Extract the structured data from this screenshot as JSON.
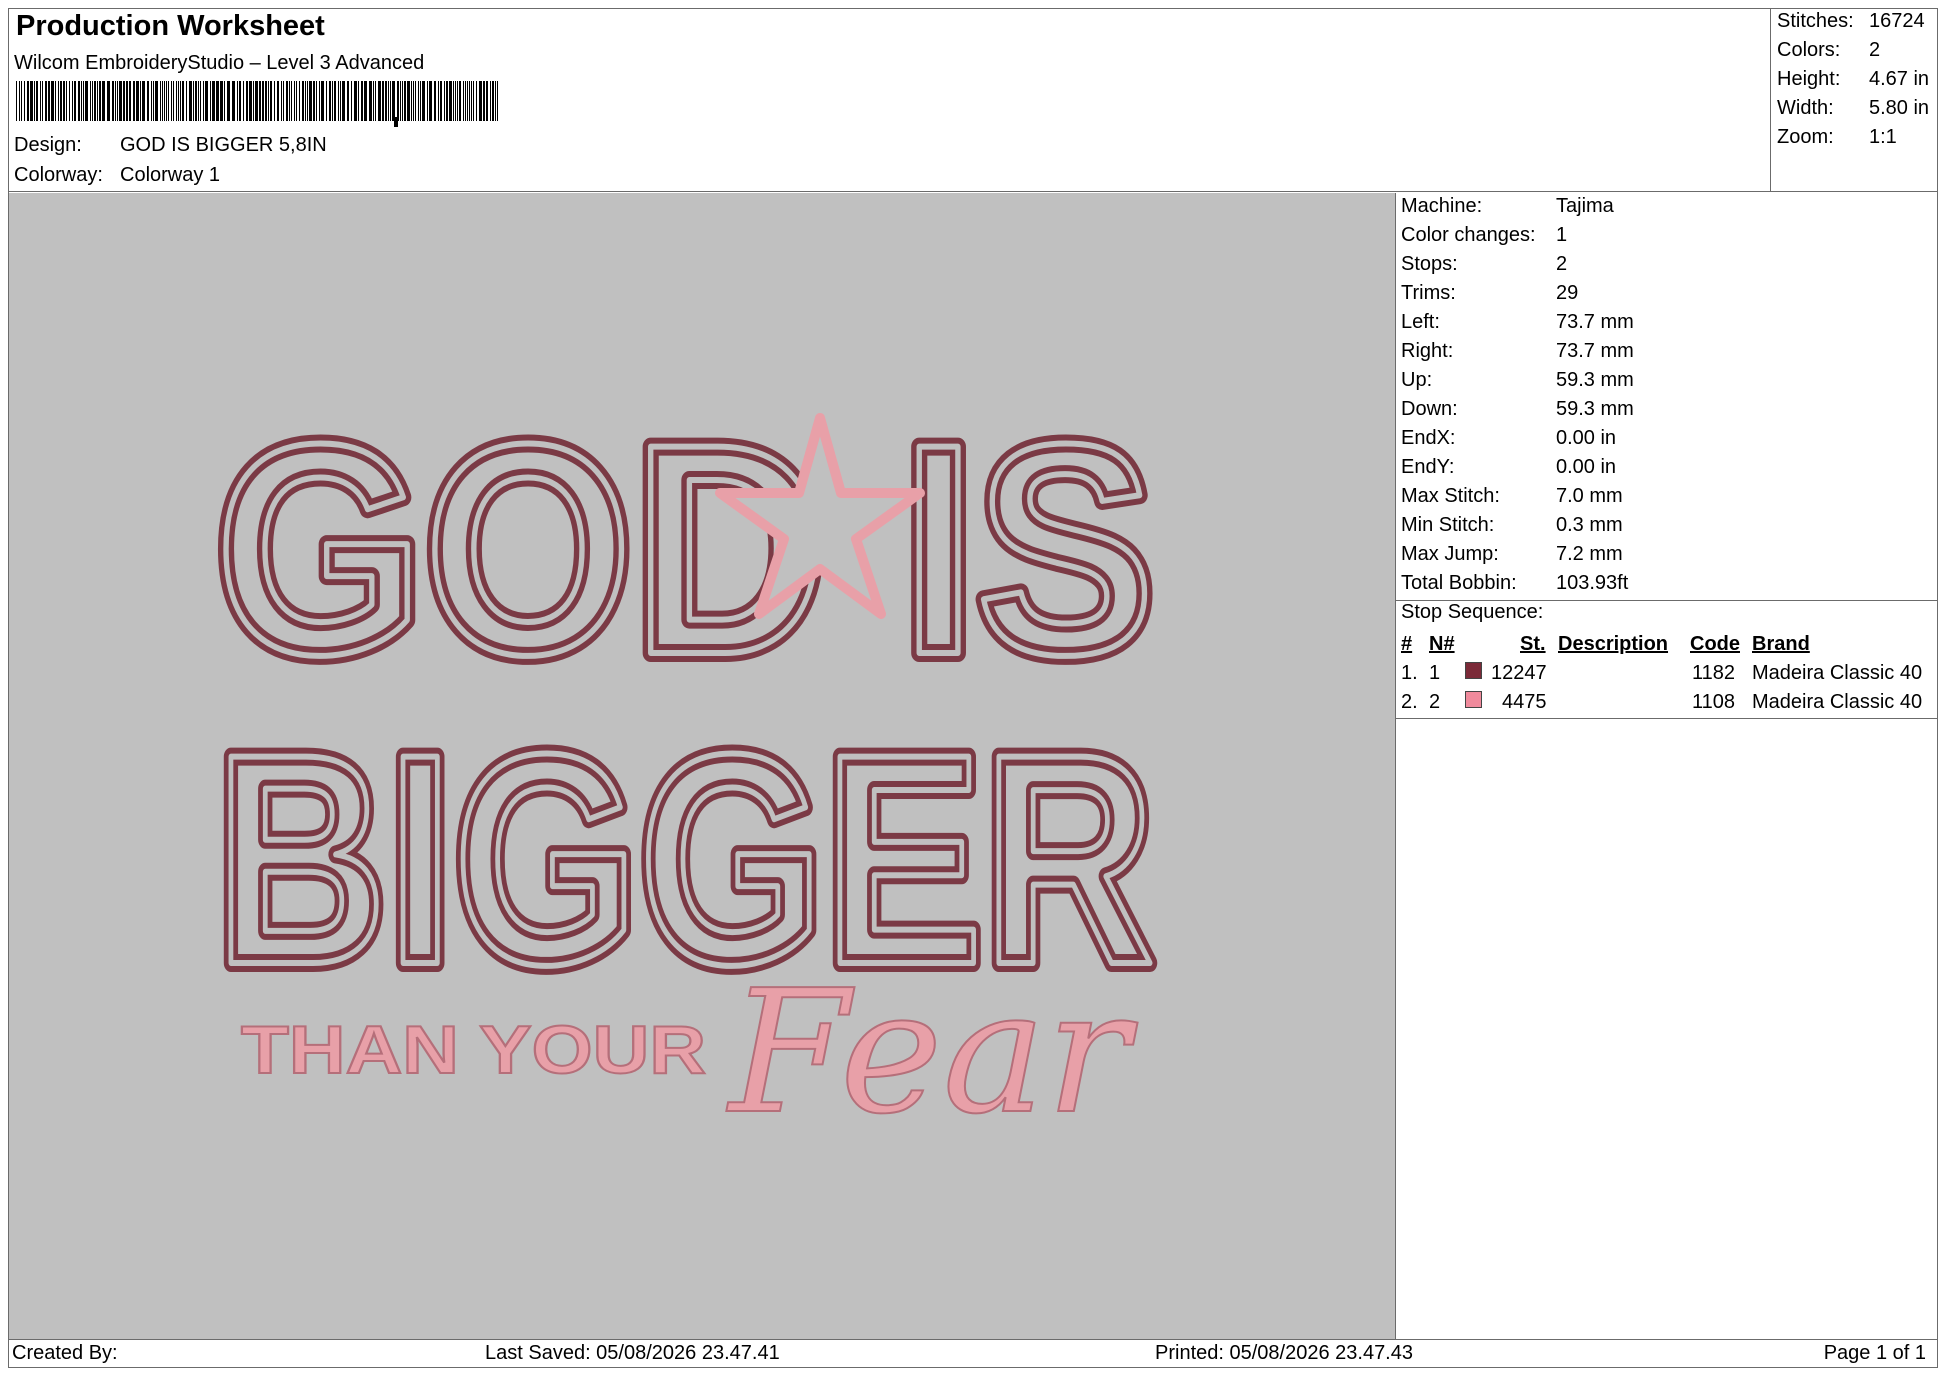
{
  "header": {
    "title": "Production Worksheet",
    "software": "Wilcom EmbroideryStudio – Level 3 Advanced",
    "design_label": "Design:",
    "design_value": "GOD IS BIGGER 5,8IN",
    "colorway_label": "Colorway:",
    "colorway_value": "Colorway 1"
  },
  "summary": {
    "stitches_label": "Stitches:",
    "stitches": "16724",
    "colors_label": "Colors:",
    "colors": "2",
    "height_label": "Height:",
    "height": "4.67 in",
    "width_label": "Width:",
    "width": "5.80 in",
    "zoom_label": "Zoom:",
    "zoom": "1:1"
  },
  "design_preview": {
    "line1": "GOD IS",
    "line2": "BIGGER",
    "line3": "THAN YOUR",
    "script_word": "Fear",
    "outline_color": "#7b3a45",
    "accent_color": "#e8a0a8",
    "background_color": "#c0c0c0"
  },
  "machine": {
    "machine_label": "Machine:",
    "machine": "Tajima",
    "color_changes_label": "Color changes:",
    "color_changes": "1",
    "stops_label": "Stops:",
    "stops": "2",
    "trims_label": "Trims:",
    "trims": "29",
    "left_label": "Left:",
    "left": "73.7 mm",
    "right_label": "Right:",
    "right": "73.7 mm",
    "up_label": "Up:",
    "up": "59.3 mm",
    "down_label": "Down:",
    "down": "59.3 mm",
    "endx_label": "EndX:",
    "endx": "0.00 in",
    "endy_label": "EndY:",
    "endy": "0.00 in",
    "max_stitch_label": "Max Stitch:",
    "max_stitch": "7.0 mm",
    "min_stitch_label": "Min Stitch:",
    "min_stitch": "0.3 mm",
    "max_jump_label": "Max Jump:",
    "max_jump": "7.2 mm",
    "total_bobbin_label": "Total Bobbin:",
    "total_bobbin": "103.93ft"
  },
  "stop_sequence": {
    "heading": "Stop Sequence:",
    "columns": [
      "#",
      "N#",
      "St.",
      "Description",
      "Code",
      "Brand"
    ],
    "rows": [
      {
        "index": "1.",
        "n": "1",
        "color": "#7b2a38",
        "stitches": "12247",
        "description": "",
        "code": "1182",
        "brand": "Madeira Classic 40"
      },
      {
        "index": "2.",
        "n": "2",
        "color": "#f08a9c",
        "stitches": "4475",
        "description": "",
        "code": "1108",
        "brand": "Madeira Classic 40"
      }
    ]
  },
  "footer": {
    "created_by": "Created By:",
    "last_saved": "Last Saved: 05/08/2026 23.47.41",
    "printed": "Printed: 05/08/2026 23.47.43",
    "page": "Page 1 of 1"
  }
}
